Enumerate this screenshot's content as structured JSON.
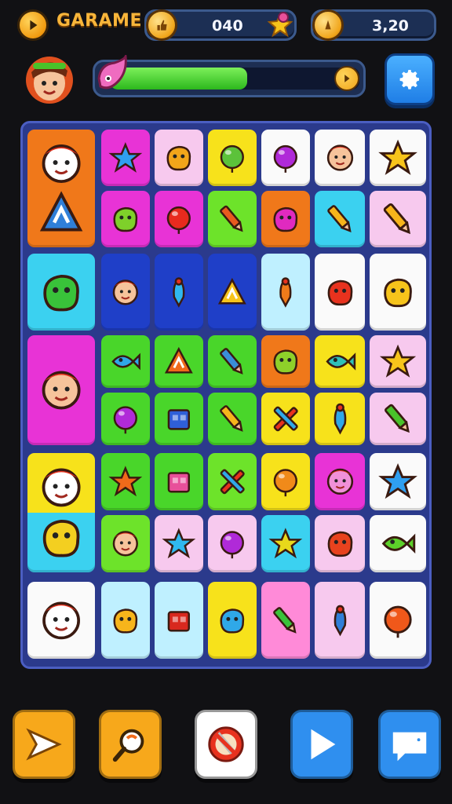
{
  "header": {
    "title": "GARAME",
    "counter_value": "040",
    "coins_value": "3,20"
  },
  "progress": {
    "value": 0.55
  },
  "colors": {
    "orange": "#f0781a",
    "magenta": "#e833d6",
    "pink_light": "#f7c9ee",
    "yellow": "#f7e21b",
    "white": "#fafafa",
    "green": "#49d62a",
    "lime": "#6de32a",
    "cyan": "#3bd1f0",
    "blue": "#1f3fc8",
    "light_cyan": "#bff0ff",
    "pink": "#ff8ad8",
    "purple_bg": "#2b3a8c"
  },
  "board": {
    "tiles": [
      {
        "color": "orange",
        "icon": "snowman-icon",
        "glyph": "face",
        "c": "#ffffff"
      },
      {
        "color": "orange",
        "icon": "road-sign-icon",
        "glyph": "tri",
        "c": "#2f7fd8"
      },
      {
        "color": "cyan",
        "icon": "green-monster-icon",
        "glyph": "blob",
        "c": "#39c23a"
      },
      {
        "color": "magenta",
        "icon": "boy-character-icon",
        "glyph": "face",
        "c": "#f6c39b"
      },
      {
        "color": "yellow",
        "icon": "carrot-snowman-icon",
        "glyph": "face",
        "c": "#ffffff"
      },
      {
        "color": "cyan",
        "icon": "yellow-creature-icon",
        "glyph": "blob",
        "c": "#f3cf20"
      },
      {
        "color": "white",
        "icon": "snowman-crown-icon",
        "glyph": "face",
        "c": "#ffffff"
      },
      {
        "color": "magenta",
        "icon": "blue-star-creature-icon",
        "glyph": "star",
        "c": "#2f9ff0"
      },
      {
        "color": "pink_light",
        "icon": "orange-blob-icon",
        "glyph": "blob",
        "c": "#f2a51a"
      },
      {
        "color": "yellow",
        "icon": "green-ball-icon",
        "glyph": "ball",
        "c": "#5cc23a"
      },
      {
        "color": "white",
        "icon": "purple-ball-icon",
        "glyph": "ball",
        "c": "#b02ad8"
      },
      {
        "color": "white",
        "icon": "girl-face-icon",
        "glyph": "face",
        "c": "#f6c39b"
      },
      {
        "color": "white",
        "icon": "gold-star-icon",
        "glyph": "star",
        "c": "#f7c41b"
      },
      {
        "color": "magenta",
        "icon": "green-robot-icon",
        "glyph": "blob",
        "c": "#7ed02a"
      },
      {
        "color": "magenta",
        "icon": "red-balloon-icon",
        "glyph": "ball",
        "c": "#e82a1e"
      },
      {
        "color": "lime",
        "icon": "pencil-icon",
        "glyph": "pencil",
        "c": "#e85a1e"
      },
      {
        "color": "orange",
        "icon": "magenta-blob-icon",
        "glyph": "blob",
        "c": "#e02ac0"
      },
      {
        "color": "cyan",
        "icon": "pencil-icon",
        "glyph": "pencil",
        "c": "#f7b51b"
      },
      {
        "color": "pink_light",
        "icon": "pencil-icon",
        "glyph": "pencil",
        "c": "#f7b51b"
      },
      {
        "color": "blue",
        "icon": "boy-face-icon",
        "glyph": "face",
        "c": "#f6c39b"
      },
      {
        "color": "blue",
        "icon": "bowling-pin-icon",
        "glyph": "pin",
        "c": "#2fb8f0"
      },
      {
        "color": "blue",
        "icon": "yellow-hat-icon",
        "glyph": "tri",
        "c": "#f7c41b"
      },
      {
        "color": "light_cyan",
        "icon": "rocket-icon",
        "glyph": "pin",
        "c": "#f07a1a"
      },
      {
        "color": "white",
        "icon": "red-creature-icon",
        "glyph": "blob",
        "c": "#e8321e"
      },
      {
        "color": "white",
        "icon": "yellow-chick-icon",
        "glyph": "blob",
        "c": "#f7c41b"
      },
      {
        "color": "green",
        "icon": "blue-fish-icon",
        "glyph": "fish",
        "c": "#2fa8e8"
      },
      {
        "color": "green",
        "icon": "orange-hat-icon",
        "glyph": "tri",
        "c": "#f06a1a"
      },
      {
        "color": "green",
        "icon": "pencil-icon",
        "glyph": "pencil",
        "c": "#3a8ed8"
      },
      {
        "color": "orange",
        "icon": "green-creature-icon",
        "glyph": "blob",
        "c": "#8ed02a"
      },
      {
        "color": "yellow",
        "icon": "teal-fish-icon",
        "glyph": "fish",
        "c": "#2fc0b8"
      },
      {
        "color": "pink_light",
        "icon": "gold-star-icon",
        "glyph": "star",
        "c": "#f7c41b"
      },
      {
        "color": "green",
        "icon": "lollipop-icon",
        "glyph": "ball",
        "c": "#b02ad8"
      },
      {
        "color": "green",
        "icon": "blue-box-icon",
        "glyph": "box",
        "c": "#2f5fd8"
      },
      {
        "color": "green",
        "icon": "pencil-icon",
        "glyph": "pencil",
        "c": "#f7b51b"
      },
      {
        "color": "yellow",
        "icon": "cross-pencils-icon",
        "glyph": "cross",
        "c": "#e8321e"
      },
      {
        "color": "yellow",
        "icon": "blue-pin-icon",
        "glyph": "pin",
        "c": "#2fa8e8"
      },
      {
        "color": "pink_light",
        "icon": "green-pencil-icon",
        "glyph": "pencil",
        "c": "#49c22a"
      },
      {
        "color": "green",
        "icon": "orange-splat-icon",
        "glyph": "star",
        "c": "#f06a1a"
      },
      {
        "color": "green",
        "icon": "pink-house-icon",
        "glyph": "box",
        "c": "#e8509a"
      },
      {
        "color": "lime",
        "icon": "cross-pencils-icon",
        "glyph": "cross",
        "c": "#e8321e"
      },
      {
        "color": "yellow",
        "icon": "orange-carrot-icon",
        "glyph": "ball",
        "c": "#f08a1a"
      },
      {
        "color": "magenta",
        "icon": "pink-bear-icon",
        "glyph": "face",
        "c": "#f090d8"
      },
      {
        "color": "white",
        "icon": "blue-flower-icon",
        "glyph": "star",
        "c": "#2f9ff0"
      },
      {
        "color": "lime",
        "icon": "cat-face-icon",
        "glyph": "face",
        "c": "#f6c39b"
      },
      {
        "color": "pink_light",
        "icon": "blue-cog-icon",
        "glyph": "star",
        "c": "#2fb8f0"
      },
      {
        "color": "pink_light",
        "icon": "purple-ball-icon",
        "glyph": "ball",
        "c": "#b02ad8"
      },
      {
        "color": "cyan",
        "icon": "yellow-bug-icon",
        "glyph": "star",
        "c": "#e8d81b"
      },
      {
        "color": "pink_light",
        "icon": "red-bird-icon",
        "glyph": "blob",
        "c": "#e8421e"
      },
      {
        "color": "white",
        "icon": "green-fish-icon",
        "glyph": "fish",
        "c": "#5cd02a"
      },
      {
        "color": "light_cyan",
        "icon": "yellow-chick-icon",
        "glyph": "blob",
        "c": "#f7b51b"
      },
      {
        "color": "light_cyan",
        "icon": "red-pinecone-icon",
        "glyph": "box",
        "c": "#d8281e"
      },
      {
        "color": "yellow",
        "icon": "blue-ghost-icon",
        "glyph": "blob",
        "c": "#2fa8e8"
      },
      {
        "color": "pink",
        "icon": "green-cactus-icon",
        "glyph": "pencil",
        "c": "#3ac23a"
      },
      {
        "color": "pink_light",
        "icon": "blue-rocket-icon",
        "glyph": "pin",
        "c": "#2f7fd8"
      },
      {
        "color": "white",
        "icon": "orange-balloon-icon",
        "glyph": "ball",
        "c": "#f0581a"
      }
    ]
  },
  "bottom_bar": [
    {
      "icon": "paper-plane-icon",
      "name": "send-button",
      "bg": "#f7a81b"
    },
    {
      "icon": "magnifier-icon",
      "name": "search-button",
      "bg": "#f7a81b"
    },
    {
      "icon": "no-pencil-icon",
      "name": "clear-button",
      "bg": "#ffffff"
    },
    {
      "icon": "play-icon",
      "name": "play-button",
      "bg": "#2f8fef"
    },
    {
      "icon": "chat-icon",
      "name": "chat-button",
      "bg": "#2f8fef"
    }
  ]
}
